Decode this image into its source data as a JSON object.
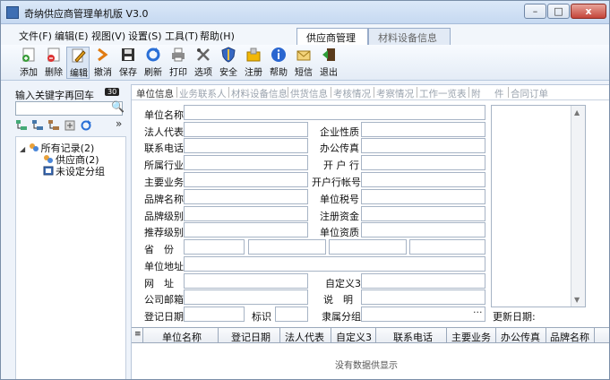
{
  "window": {
    "title": "奇纳供应商管理单机版 V3.0",
    "buttons": {
      "minimize": "–",
      "maximize": "□",
      "close": "x"
    }
  },
  "menu": [
    "文件(F)",
    "编辑(E)",
    "视图(V)",
    "设置(S)",
    "工具(T)",
    "帮助(H)"
  ],
  "top_tabs": [
    {
      "label": "供应商管理",
      "active": true
    },
    {
      "label": "材料设备信息",
      "active": false
    }
  ],
  "toolbar": [
    {
      "label": "添加",
      "icon": "add-icon"
    },
    {
      "label": "删除",
      "icon": "delete-icon"
    },
    {
      "label": "编辑",
      "icon": "edit-icon",
      "pressed": true
    },
    {
      "label": "撤消",
      "icon": "undo-icon"
    },
    {
      "label": "保存",
      "icon": "save-icon"
    },
    {
      "label": "刷新",
      "icon": "refresh-icon"
    },
    {
      "label": "打印",
      "icon": "print-icon"
    },
    {
      "label": "选项",
      "icon": "options-icon"
    },
    {
      "label": "安全",
      "icon": "security-icon"
    },
    {
      "label": "注册",
      "icon": "register-icon"
    },
    {
      "label": "帮助",
      "icon": "help-icon"
    },
    {
      "label": "短信",
      "icon": "sms-icon"
    },
    {
      "label": "退出",
      "icon": "exit-icon"
    }
  ],
  "search": {
    "label": "输入关键字再回车",
    "badge": "30",
    "placeholder": ""
  },
  "tree_toolbar_more": "»",
  "tree": {
    "root": "所有记录(2)",
    "children": [
      "供应商(2)",
      "未设定分组"
    ]
  },
  "subtabs": [
    "单位信息",
    "业务联系人",
    "材料设备信息",
    "供货信息",
    "考核情况",
    "考察情况",
    "工作一览表",
    "附",
    "件",
    "合同订单"
  ],
  "form": {
    "unit_name": "单位名称",
    "legal_rep": "法人代表",
    "enterprise_type": "企业性质",
    "phone": "联系电话",
    "office_fax": "办公传真",
    "industry": "所属行业",
    "bank": "开 户 行",
    "main_business": "主要业务",
    "bank_account": "开户行帐号",
    "brand_name": "品牌名称",
    "tax_no": "单位税号",
    "brand_level": "品牌级别",
    "registered_capital": "注册资金",
    "recommend_level": "推荐级别",
    "qualification": "单位资质",
    "province": "省　份",
    "address": "单位地址",
    "website": "网　址",
    "custom3": "自定义3",
    "email": "公司邮箱",
    "description": "说　明",
    "reg_date": "登记日期",
    "flag": "标识",
    "group": "隶属分组",
    "ellipsis": "···",
    "update_date": "更新日期:"
  },
  "grid": {
    "columns": [
      "单位名称",
      "登记日期",
      "法人代表",
      "自定义3",
      "联系电话",
      "主要业务",
      "办公传真",
      "品牌名称"
    ],
    "empty_message": "没有数据供显示"
  },
  "colors": {
    "accent": "#3f6fb3",
    "window_bg": "#eef3fa"
  }
}
